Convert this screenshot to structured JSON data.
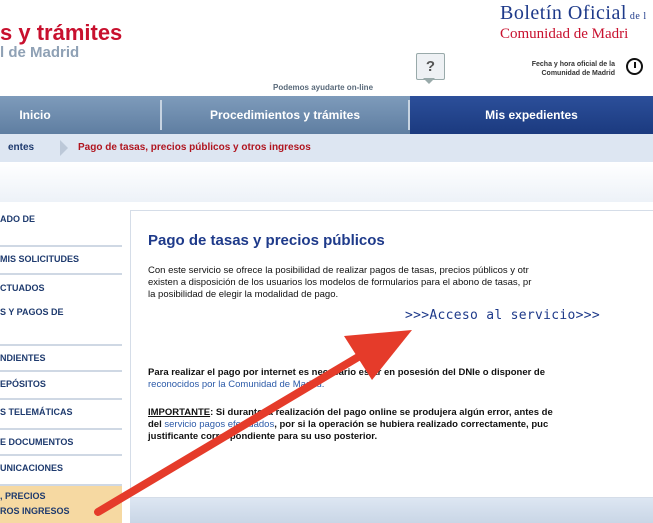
{
  "header": {
    "brand_title": "s y trámites",
    "brand_subtitle": "l de Madrid",
    "help_text": "Podemos ayudarte on-line",
    "help_icon_glyph": "?",
    "bo_title_big": "Boletín Oficial",
    "bo_title_small": " de l",
    "bo_subtitle": "Comunidad de Madri",
    "fecha_line1": "Fecha y hora oficial de la",
    "fecha_line2": "Comunidad de Madrid"
  },
  "nav": {
    "tabs": [
      {
        "label": "Inicio"
      },
      {
        "label": "Procedimientos y trámites"
      },
      {
        "label": "Mis expedientes"
      }
    ]
  },
  "breadcrumb": {
    "items": [
      "entes",
      "Pago de tasas, precios públicos y otros ingresos"
    ]
  },
  "sidebar": {
    "items": [
      {
        "label": "ADO DE"
      },
      {
        "label": "MIS SOLICITUDES"
      },
      {
        "label": "CTUADOS"
      },
      {
        "label": "S Y PAGOS DE"
      },
      {
        "label": "NDIENTES"
      },
      {
        "label": "EPÓSITOS"
      },
      {
        "label": "S TELEMÁTICAS"
      },
      {
        "label": "E DOCUMENTOS"
      },
      {
        "label": "UNICACIONES"
      },
      {
        "label": ", PRECIOS"
      },
      {
        "label": "ROS INGRESOS"
      }
    ]
  },
  "content": {
    "title": "Pago de tasas y precios públicos",
    "intro_lines": [
      "Con este servicio se ofrece la posibilidad de realizar pagos de tasas, precios públicos y otr",
      "existen a disposición de los usuarios los modelos de formularios para el abono de tasas, pr",
      "la posibilidad de elegir la modalidad de pago."
    ],
    "access_link": ">>>Acceso al servicio>>>",
    "req_line1": "Para realizar el pago por internet es necesario estar en posesión del DNIe o disponer de",
    "req_link": "reconocidos por la Comunidad de Madrid.",
    "imp_label": "IMPORTANTE",
    "imp_line1": ": Si durante la realización del pago online se produjera algún error, antes de",
    "imp_line2_pre": "del ",
    "imp_line2_link": "servicio pagos efectuados",
    "imp_line2_post": ", por si la operación se hubiera realizado correctamente, puc",
    "imp_line3": "justificante correspondiente para su uso posterior."
  },
  "colors": {
    "brand_red": "#c8102e",
    "nav_blue": "#5f7ea1",
    "active_tab": "#1b3a7f",
    "arrow_red": "#e53b2a",
    "highlight": "#f6d9a2"
  },
  "icons": {
    "help": "help-question-icon",
    "clock": "clock-icon",
    "arrow": "red-arrow-annotation"
  }
}
